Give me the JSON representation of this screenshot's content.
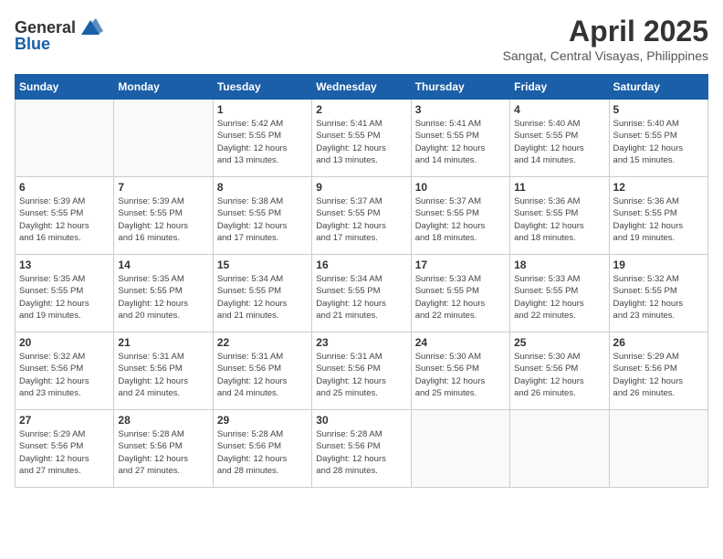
{
  "logo": {
    "general": "General",
    "blue": "Blue"
  },
  "title": {
    "month_year": "April 2025",
    "location": "Sangat, Central Visayas, Philippines"
  },
  "headers": [
    "Sunday",
    "Monday",
    "Tuesday",
    "Wednesday",
    "Thursday",
    "Friday",
    "Saturday"
  ],
  "weeks": [
    [
      {
        "day": "",
        "info": ""
      },
      {
        "day": "",
        "info": ""
      },
      {
        "day": "1",
        "info": "Sunrise: 5:42 AM\nSunset: 5:55 PM\nDaylight: 12 hours\nand 13 minutes."
      },
      {
        "day": "2",
        "info": "Sunrise: 5:41 AM\nSunset: 5:55 PM\nDaylight: 12 hours\nand 13 minutes."
      },
      {
        "day": "3",
        "info": "Sunrise: 5:41 AM\nSunset: 5:55 PM\nDaylight: 12 hours\nand 14 minutes."
      },
      {
        "day": "4",
        "info": "Sunrise: 5:40 AM\nSunset: 5:55 PM\nDaylight: 12 hours\nand 14 minutes."
      },
      {
        "day": "5",
        "info": "Sunrise: 5:40 AM\nSunset: 5:55 PM\nDaylight: 12 hours\nand 15 minutes."
      }
    ],
    [
      {
        "day": "6",
        "info": "Sunrise: 5:39 AM\nSunset: 5:55 PM\nDaylight: 12 hours\nand 16 minutes."
      },
      {
        "day": "7",
        "info": "Sunrise: 5:39 AM\nSunset: 5:55 PM\nDaylight: 12 hours\nand 16 minutes."
      },
      {
        "day": "8",
        "info": "Sunrise: 5:38 AM\nSunset: 5:55 PM\nDaylight: 12 hours\nand 17 minutes."
      },
      {
        "day": "9",
        "info": "Sunrise: 5:37 AM\nSunset: 5:55 PM\nDaylight: 12 hours\nand 17 minutes."
      },
      {
        "day": "10",
        "info": "Sunrise: 5:37 AM\nSunset: 5:55 PM\nDaylight: 12 hours\nand 18 minutes."
      },
      {
        "day": "11",
        "info": "Sunrise: 5:36 AM\nSunset: 5:55 PM\nDaylight: 12 hours\nand 18 minutes."
      },
      {
        "day": "12",
        "info": "Sunrise: 5:36 AM\nSunset: 5:55 PM\nDaylight: 12 hours\nand 19 minutes."
      }
    ],
    [
      {
        "day": "13",
        "info": "Sunrise: 5:35 AM\nSunset: 5:55 PM\nDaylight: 12 hours\nand 19 minutes."
      },
      {
        "day": "14",
        "info": "Sunrise: 5:35 AM\nSunset: 5:55 PM\nDaylight: 12 hours\nand 20 minutes."
      },
      {
        "day": "15",
        "info": "Sunrise: 5:34 AM\nSunset: 5:55 PM\nDaylight: 12 hours\nand 21 minutes."
      },
      {
        "day": "16",
        "info": "Sunrise: 5:34 AM\nSunset: 5:55 PM\nDaylight: 12 hours\nand 21 minutes."
      },
      {
        "day": "17",
        "info": "Sunrise: 5:33 AM\nSunset: 5:55 PM\nDaylight: 12 hours\nand 22 minutes."
      },
      {
        "day": "18",
        "info": "Sunrise: 5:33 AM\nSunset: 5:55 PM\nDaylight: 12 hours\nand 22 minutes."
      },
      {
        "day": "19",
        "info": "Sunrise: 5:32 AM\nSunset: 5:55 PM\nDaylight: 12 hours\nand 23 minutes."
      }
    ],
    [
      {
        "day": "20",
        "info": "Sunrise: 5:32 AM\nSunset: 5:56 PM\nDaylight: 12 hours\nand 23 minutes."
      },
      {
        "day": "21",
        "info": "Sunrise: 5:31 AM\nSunset: 5:56 PM\nDaylight: 12 hours\nand 24 minutes."
      },
      {
        "day": "22",
        "info": "Sunrise: 5:31 AM\nSunset: 5:56 PM\nDaylight: 12 hours\nand 24 minutes."
      },
      {
        "day": "23",
        "info": "Sunrise: 5:31 AM\nSunset: 5:56 PM\nDaylight: 12 hours\nand 25 minutes."
      },
      {
        "day": "24",
        "info": "Sunrise: 5:30 AM\nSunset: 5:56 PM\nDaylight: 12 hours\nand 25 minutes."
      },
      {
        "day": "25",
        "info": "Sunrise: 5:30 AM\nSunset: 5:56 PM\nDaylight: 12 hours\nand 26 minutes."
      },
      {
        "day": "26",
        "info": "Sunrise: 5:29 AM\nSunset: 5:56 PM\nDaylight: 12 hours\nand 26 minutes."
      }
    ],
    [
      {
        "day": "27",
        "info": "Sunrise: 5:29 AM\nSunset: 5:56 PM\nDaylight: 12 hours\nand 27 minutes."
      },
      {
        "day": "28",
        "info": "Sunrise: 5:28 AM\nSunset: 5:56 PM\nDaylight: 12 hours\nand 27 minutes."
      },
      {
        "day": "29",
        "info": "Sunrise: 5:28 AM\nSunset: 5:56 PM\nDaylight: 12 hours\nand 28 minutes."
      },
      {
        "day": "30",
        "info": "Sunrise: 5:28 AM\nSunset: 5:56 PM\nDaylight: 12 hours\nand 28 minutes."
      },
      {
        "day": "",
        "info": ""
      },
      {
        "day": "",
        "info": ""
      },
      {
        "day": "",
        "info": ""
      }
    ]
  ]
}
